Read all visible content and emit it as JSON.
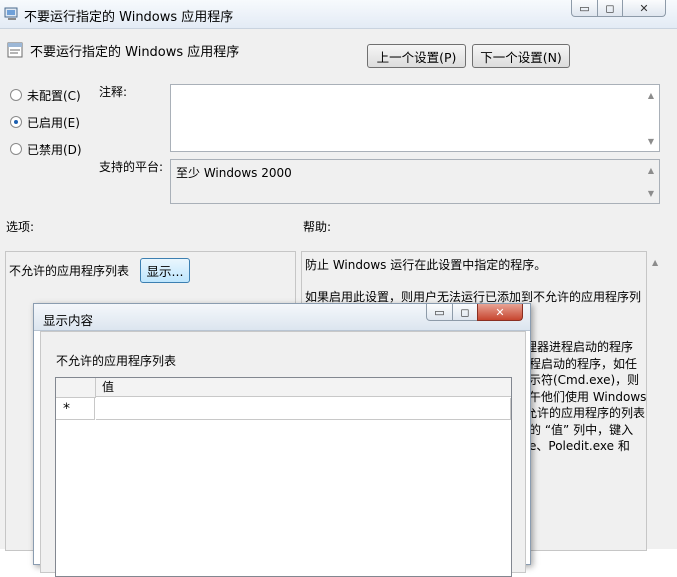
{
  "main_window": {
    "title": "不要运行指定的 Windows 应用程序",
    "header_title": "不要运行指定的 Windows 应用程序",
    "window_controls": {
      "minimize": "▭",
      "maximize": "◻",
      "close": "✕"
    },
    "prev_setting_button": "上一个设置(P)",
    "next_setting_button": "下一个设置(N)",
    "radios": [
      {
        "label": "未配置(C)",
        "checked": false
      },
      {
        "label": "已启用(E)",
        "checked": true
      },
      {
        "label": "已禁用(D)",
        "checked": false
      }
    ],
    "comment_label": "注释:",
    "comment_value": "",
    "platform_label": "支持的平台:",
    "platform_value": "至少 Windows 2000",
    "options_label": "选项:",
    "help_label": "帮助:",
    "option_list_label": "不允许的应用程序列表",
    "show_button": "显示...",
    "help_text": [
      "防止 Windows 运行在此设置中指定的程序。",
      "",
      "如果启用此设置，则用户无法运行已添加到不允许的应用程序列",
      "",
      "",
      "理器进程启动的程序",
      "程启动的程序，如任",
      "示符(Cmd.exe)，则",
      "午他们使用 Windows",
      "允许的应用程序的列表",
      "的 “值” 列中，键入",
      "e、Poledit.exe 和"
    ]
  },
  "dialog": {
    "title": "显示内容",
    "window_controls": {
      "minimize": "▭",
      "maximize": "◻",
      "close": "✕"
    },
    "list_label": "不允许的应用程序列表",
    "grid": {
      "column_header": "值",
      "new_row_marker": "*",
      "new_row_value": ""
    }
  }
}
